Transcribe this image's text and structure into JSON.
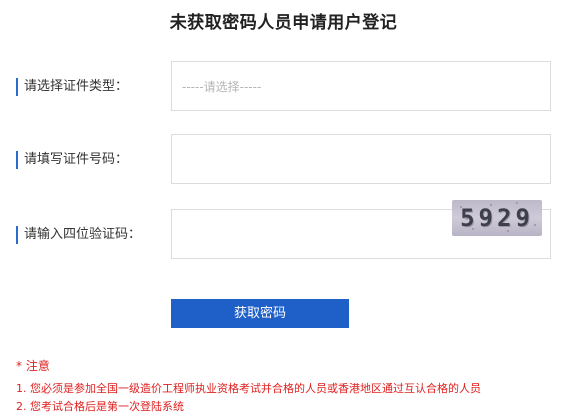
{
  "page": {
    "title": "未获取密码人员申请用户登记"
  },
  "form": {
    "cert_type": {
      "label": "请选择证件类型：",
      "placeholder": "-----请选择-----"
    },
    "cert_number": {
      "label": "请填写证件号码："
    },
    "captcha": {
      "label": "请输入四位验证码：",
      "code": "5929"
    },
    "submit_label": "获取密码"
  },
  "notice": {
    "title": "* 注意",
    "items": [
      "1. 您必须是参加全国一级造价工程师执业资格考试并合格的人员或香港地区通过互认合格的人员",
      "2. 您考试合格后是第一次登陆系统"
    ]
  },
  "colors": {
    "accent": "#1f5fc8",
    "notice": "#e02020",
    "label_bar": "#2a6bd0"
  }
}
